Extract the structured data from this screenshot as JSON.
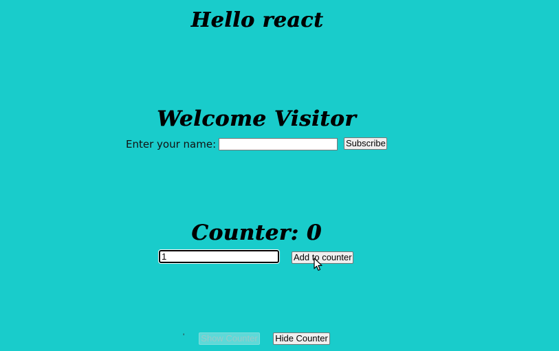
{
  "header": {
    "title": "Hello react"
  },
  "welcome": {
    "heading": "Welcome Visitor",
    "name_label": "Enter your name:",
    "name_value": "",
    "subscribe_label": "Subscribe"
  },
  "counter": {
    "heading": "Counter: 0",
    "input_value": "1",
    "add_label": "Add to counter"
  },
  "footer": {
    "stray_mark": "'",
    "show_label": "Show Counter",
    "show_disabled": true,
    "hide_label": "Hide Counter"
  },
  "colors": {
    "background": "#19cccb",
    "button_bg": "#efefef",
    "disabled_button_bg": "#5ed9d8"
  },
  "icons": {
    "cursor": "pointer-arrow-icon"
  }
}
